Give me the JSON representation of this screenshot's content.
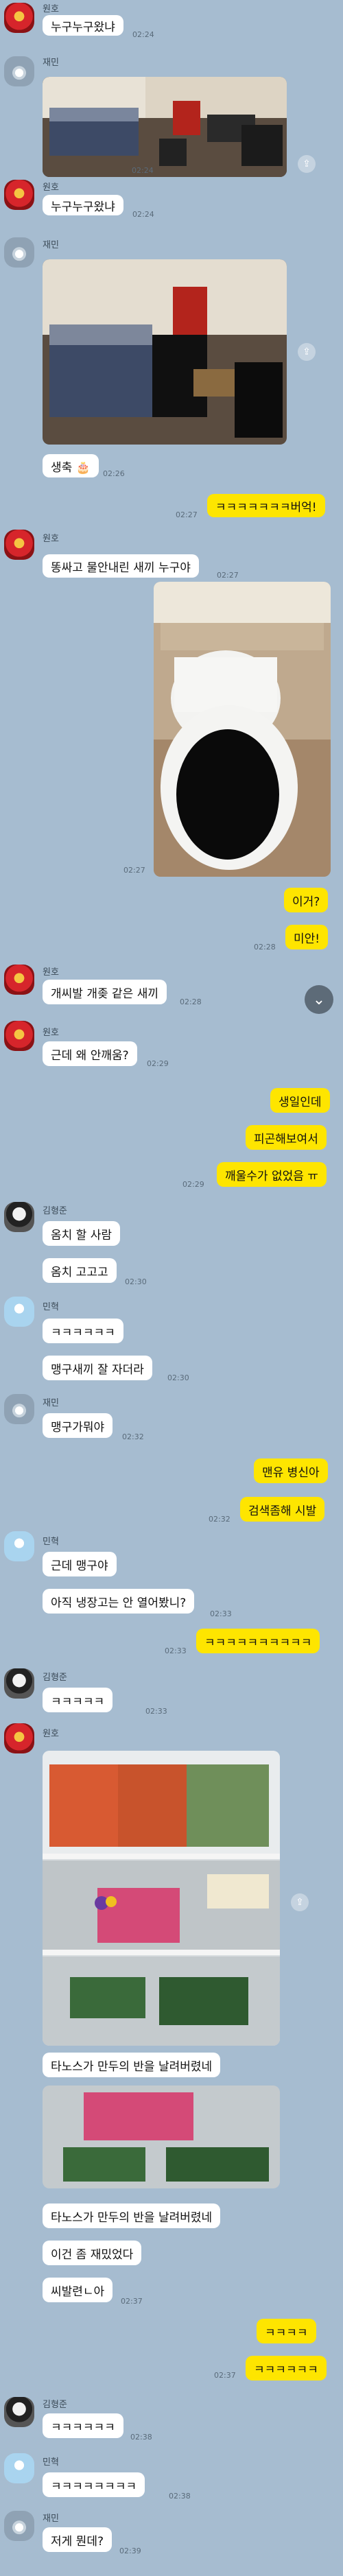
{
  "messages": {
    "m1": {
      "name": "원호",
      "text": "누구누구왔냐",
      "time": "02:24"
    },
    "m2": {
      "name": "재민",
      "time": "02:24"
    },
    "m3": {
      "name": "원호",
      "text": "누구누구왔냐",
      "time": "02:24"
    },
    "m4": {
      "name": "재민",
      "text": "생축 🎂",
      "time": "02:26"
    },
    "m5": {
      "text": "ㅋㅋㅋㅋㅋㅋㅋ버억!",
      "time": "02:27"
    },
    "m6": {
      "name": "원호",
      "text": "똥싸고 물안내린 새끼 누구야",
      "time": "02:27",
      "time2": "02:27"
    },
    "m7": {
      "text1": "이거?",
      "time1": "02:28",
      "text2": "미안!"
    },
    "m8": {
      "name": "원호",
      "text": "개씨발 개좆 같은 새끼",
      "time": "02:28"
    },
    "m9": {
      "name": "원호",
      "text": "근데 왜 안깨움?",
      "time": "02:29"
    },
    "m10": {
      "text1": "생일인데",
      "text2": "피곤해보여서",
      "text3": "깨울수가 없었음 ㅠ",
      "time": "02:29"
    },
    "m11": {
      "name": "김형준",
      "text1": "옴치 할 사람",
      "text2": "옴치 고고고",
      "time": "02:30"
    },
    "m12": {
      "name": "민혁",
      "text1": "ㅋㅋㅋㅋㅋㅋ",
      "text2": "맹구새끼 잘 자더라",
      "time": "02:30"
    },
    "m13": {
      "name": "재민",
      "text": "맹구가뭐야",
      "time": "02:32"
    },
    "m14": {
      "text1": "맨유 병신아",
      "text2": "검색좀해 시발",
      "time": "02:32"
    },
    "m15": {
      "name": "민혁",
      "text1": "근데 맹구야",
      "text2": "아직 냉장고는 안 열어봤니?",
      "time": "02:33"
    },
    "m16": {
      "text": "ㅋㅋㅋㅋㅋㅋㅋㅋㅋㅋ",
      "time": "02:33"
    },
    "m17": {
      "name": "김형준",
      "text": "ㅋㅋㅋㅋㅋ",
      "time": "02:33"
    },
    "m18": {
      "name": "원호",
      "text1": "타노스가 만두의 반을 날려버렸네",
      "text2": "타노스가 만두의 반을 날려버렸네",
      "text3": "이건 좀 재밌었다",
      "text4": "씨발련ㄴ아",
      "time": "02:37"
    },
    "m19": {
      "text1": "ㅋㅋㅋㅋ",
      "text2": "ㅋㅋㅋㅋㅋㅋ",
      "time": "02:37"
    },
    "m20": {
      "name": "김형준",
      "text": "ㅋㅋㅋㅋㅋㅋ",
      "time": "02:38"
    },
    "m21": {
      "name": "민혁",
      "text": "ㅋㅋㅋㅋㅋㅋㅋㅋ",
      "time": "02:38"
    },
    "m22": {
      "name": "재민",
      "text": "저게 뭔데?",
      "time": "02:39"
    }
  },
  "icons": {
    "share": "share-icon",
    "scroll_down": "chevron-down-icon"
  },
  "colors": {
    "background": "#a6bcd0",
    "my_bubble": "#fee500",
    "their_bubble": "#ffffff"
  }
}
